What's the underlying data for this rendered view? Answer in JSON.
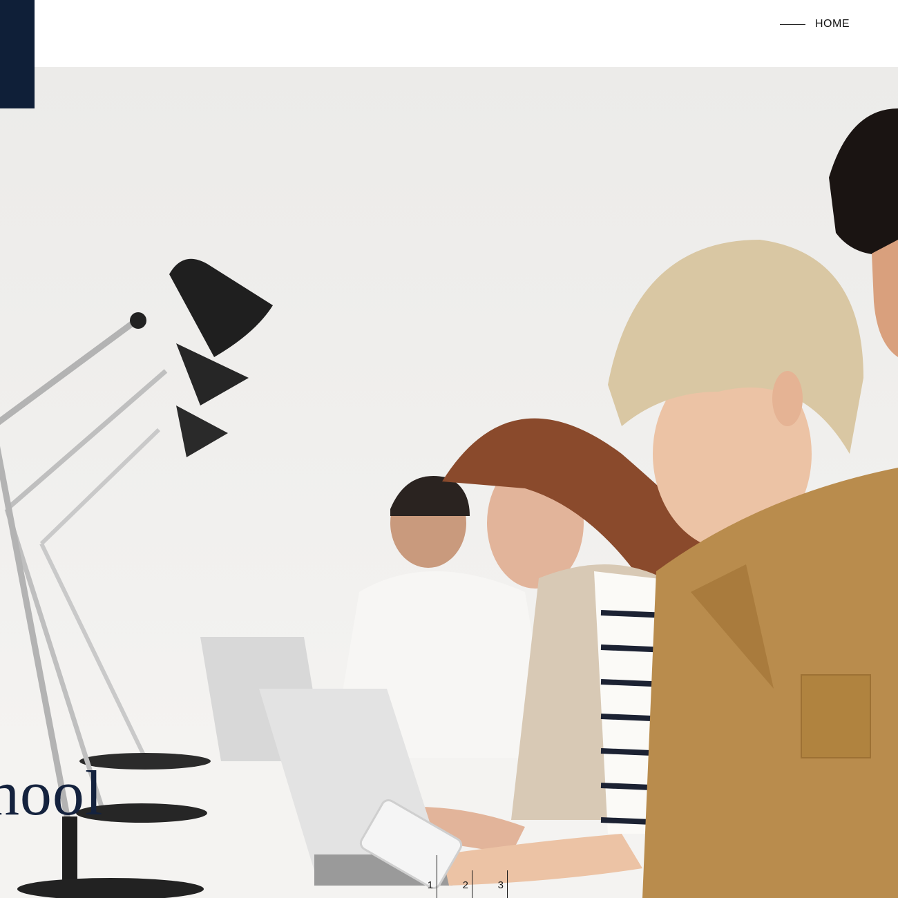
{
  "header": {
    "nav": [
      {
        "label": "HOME"
      }
    ]
  },
  "hero": {
    "title_fragment": "chool",
    "image_description_icon": "classroom-photo"
  },
  "pager": {
    "items": [
      "1",
      "2",
      "3"
    ],
    "active_index": 0
  },
  "colors": {
    "brand_navy": "#0f1f38",
    "title_navy": "#14223e"
  }
}
